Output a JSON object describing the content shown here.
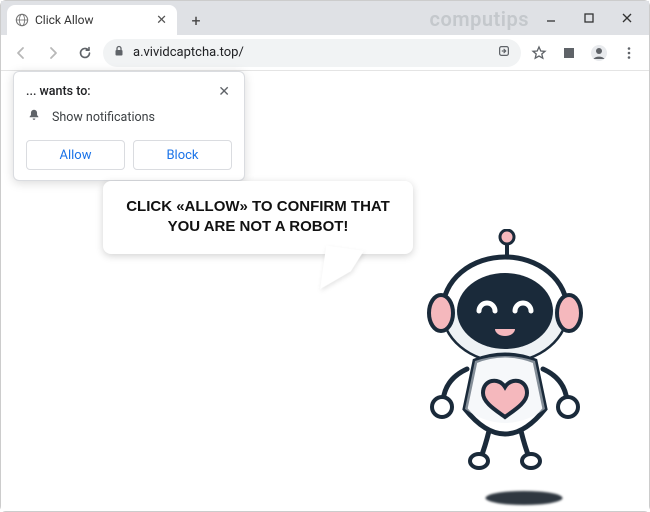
{
  "window": {
    "watermark": "computips"
  },
  "tab": {
    "title": "Click Allow"
  },
  "toolbar": {
    "url": "a.vividcaptcha.top/"
  },
  "permission": {
    "title": "... wants to:",
    "item": "Show notifications",
    "allow": "Allow",
    "block": "Block"
  },
  "page": {
    "speech": "CLICK «ALLOW» TO CONFIRM THAT YOU ARE NOT A ROBOT!"
  }
}
